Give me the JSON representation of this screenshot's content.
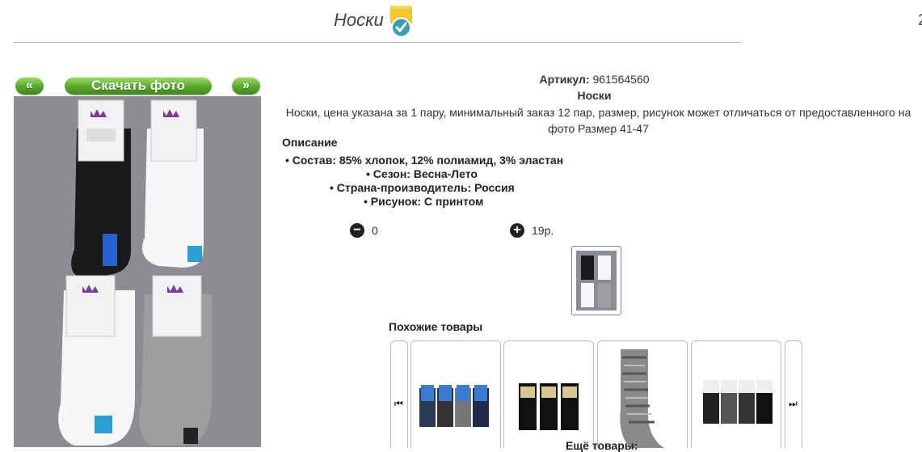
{
  "header": {
    "title": "Носки",
    "edge_char": "2"
  },
  "photo": {
    "prev_label": "«",
    "download_label": "Скачать фото",
    "next_label": "»"
  },
  "product": {
    "sku_label": "Артикул:",
    "sku": "961564560",
    "name": "Носки",
    "description": "Носки, цена указана за 1 пару, минимальный заказ 12 пар, размер, рисунок может отличаться от предоставленного на фото Размер 41-47",
    "description_title": "Описание",
    "features": [
      "Состав: 85% хлопок, 12% полиамид, 3% эластан",
      "Сезон: Весна-Лето",
      "Страна-производитель: Россия",
      "Рисунок: С принтом"
    ]
  },
  "order": {
    "quantity": "0",
    "price": "19р."
  },
  "similar": {
    "title": "Похожие товары",
    "more_label": "Ещё товары:"
  },
  "colors": {
    "button_green": "#58a82c",
    "photo_bg": "#8c8d92"
  }
}
